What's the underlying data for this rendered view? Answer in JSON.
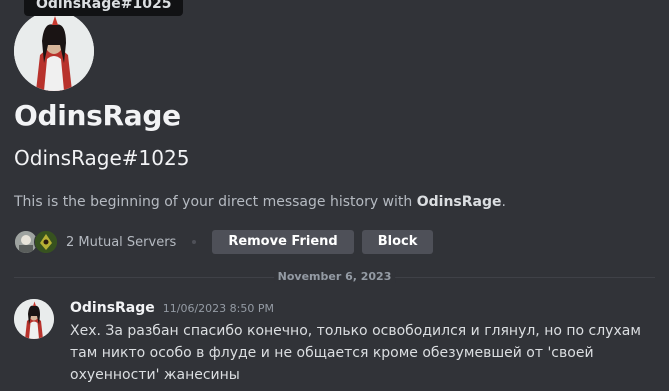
{
  "tooltip": "OdinsRage#1025",
  "profile": {
    "username": "OdinsRage",
    "tag": "OdinsRage#1025",
    "intro_prefix": "This is the beginning of your direct message history with ",
    "intro_name": "OdinsRage",
    "intro_suffix": "."
  },
  "actions": {
    "mutual_servers": "2 Mutual Servers",
    "remove_friend": "Remove Friend",
    "block": "Block"
  },
  "date_divider": "November 6, 2023",
  "message": {
    "author": "OdinsRage",
    "timestamp": "11/06/2023 8:50 PM",
    "text": "Хех. За разбан спасибо конечно, только освободился и глянул, но по слухам там никто особо в флуде и не общается кроме обезумевшей от 'своей охуенности' жанесины"
  },
  "colors": {
    "background": "#313338",
    "button": "#4e5058",
    "tooltip_bg": "#111214",
    "muted_text": "#949ba4"
  }
}
